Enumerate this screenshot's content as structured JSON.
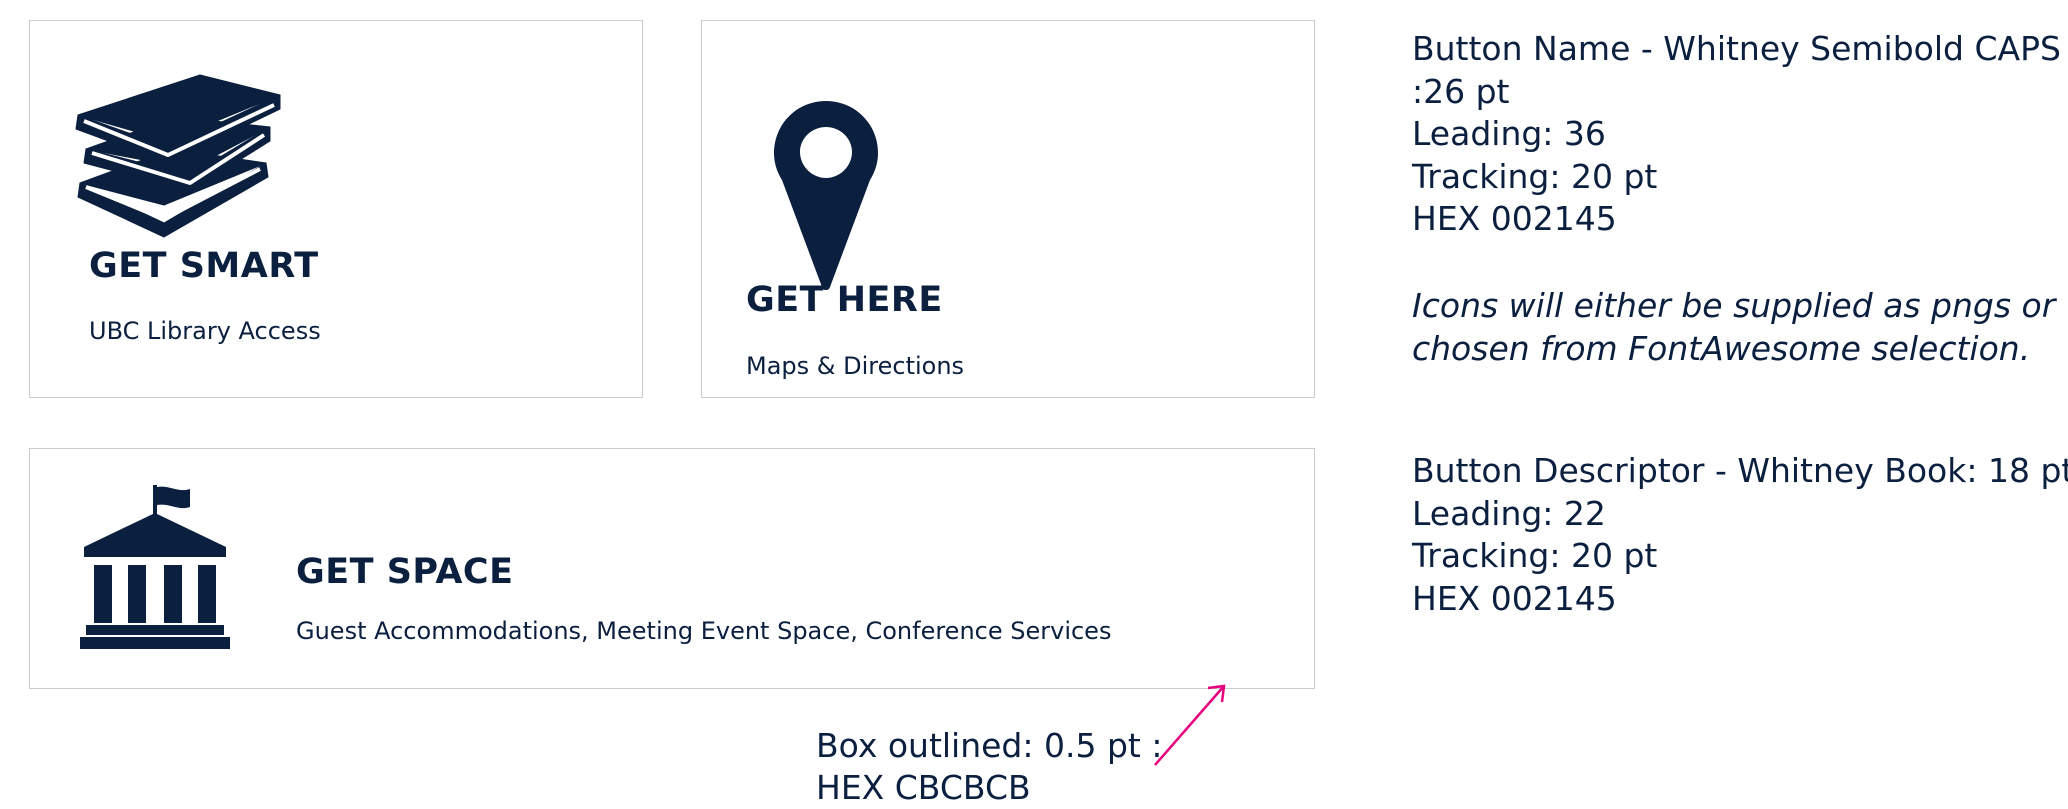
{
  "cards": [
    {
      "icon": "books-icon",
      "title": "GET SMART",
      "description": "UBC Library Access"
    },
    {
      "icon": "map-pin-icon",
      "title": "GET HERE",
      "description": "Maps & Directions"
    },
    {
      "icon": "university-building-icon",
      "title": "GET SPACE",
      "description": "Guest Accommodations, Meeting Event Space, Conference Services"
    }
  ],
  "specs": {
    "button_name": [
      "Button Name - Whitney Semibold CAPS",
      ":26 pt",
      "Leading: 36",
      "Tracking: 20 pt",
      "HEX 002145"
    ],
    "icons_note": [
      "Icons will either be supplied as pngs or",
      "chosen from FontAwesome selection."
    ],
    "button_descriptor": [
      "Button Descriptor - Whitney Book: 18 pt",
      "Leading: 22",
      "Tracking: 20 pt",
      "HEX 002145"
    ]
  },
  "box_note": [
    "Box outlined: 0.5 pt :",
    "HEX CBCBCB"
  ],
  "colors": {
    "text": "#002145",
    "border": "#CBCBCB",
    "arrow": "#E6007E"
  }
}
